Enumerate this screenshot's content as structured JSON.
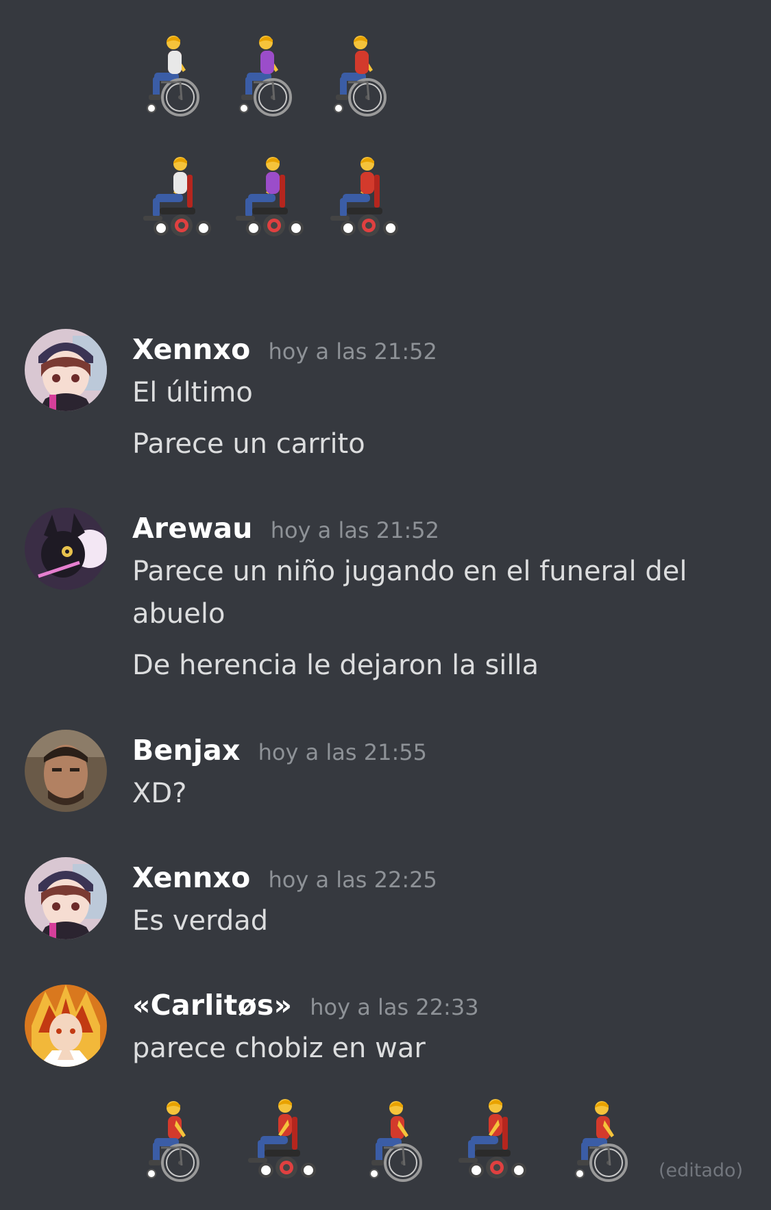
{
  "colors": {
    "background": "#36393f",
    "username": "#ffffff",
    "timestamp": "#8e9297",
    "message_text": "#dcddde",
    "edited": "#72767d"
  },
  "top_emojis": [
    {
      "icon": "manual-wheelchair-person-white-shirt"
    },
    {
      "icon": "manual-wheelchair-woman-purple-shirt"
    },
    {
      "icon": "manual-wheelchair-man-red-shirt"
    },
    {
      "icon": "motorized-wheelchair-person-white-shirt"
    },
    {
      "icon": "motorized-wheelchair-woman-purple-shirt"
    },
    {
      "icon": "motorized-wheelchair-man-red-shirt"
    }
  ],
  "messages": [
    {
      "username": "Xennxo",
      "timestamp": "hoy a las 21:52",
      "avatar_icon": "anime-girl-cap-avatar",
      "lines": [
        "El último",
        "Parece un carrito"
      ]
    },
    {
      "username": "Arewau",
      "timestamp": "hoy a las 21:52",
      "avatar_icon": "umbreon-avatar",
      "lines": [
        "Parece un niño jugando en el funeral del",
        "abuelo",
        "De herencia le dejaron la silla"
      ]
    },
    {
      "username": "Benjax",
      "timestamp": "hoy a las 21:55",
      "avatar_icon": "man-photo-avatar",
      "lines": [
        "XD?"
      ]
    },
    {
      "username": "Xennxo",
      "timestamp": "hoy a las 22:25",
      "avatar_icon": "anime-girl-cap-avatar",
      "lines": [
        "Es verdad"
      ]
    },
    {
      "username": "«Carlitøs»",
      "timestamp": "hoy a las 22:33",
      "avatar_icon": "flame-hair-anime-avatar",
      "lines": [
        "parece chobiz en war"
      ]
    }
  ],
  "bottom_emojis": [
    {
      "icon": "manual-wheelchair-man-red-shirt"
    },
    {
      "icon": "motorized-wheelchair-man-red-shirt"
    },
    {
      "icon": "manual-wheelchair-man-red-shirt"
    },
    {
      "icon": "motorized-wheelchair-man-red-shirt"
    },
    {
      "icon": "manual-wheelchair-man-red-shirt"
    }
  ],
  "edited_label": "(editado)"
}
